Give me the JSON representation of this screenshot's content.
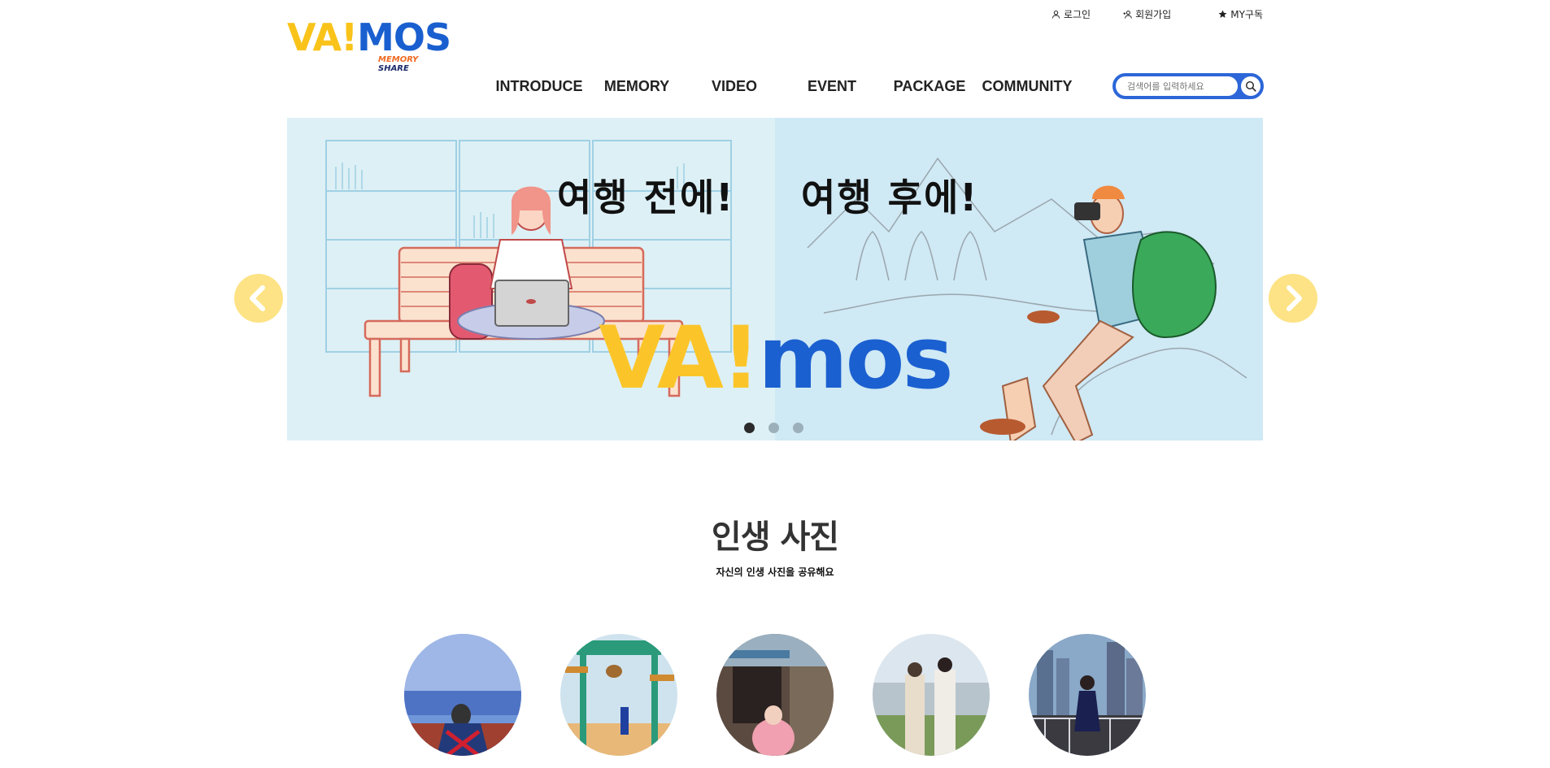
{
  "util": {
    "login": "로그인",
    "join": "회원가입",
    "subscribe": "MY구독"
  },
  "logo": {
    "word_yellow": "VA!",
    "word_blue": "MOS",
    "sub_memory": "MEMORY",
    "sub_share": "SHARE"
  },
  "nav": {
    "items": [
      "INTRODUCE",
      "MEMORY",
      "VIDEO",
      "EVENT",
      "PACKAGE",
      "COMMUNITY"
    ]
  },
  "search": {
    "placeholder": "검색어를 입력하세요"
  },
  "banner": {
    "heading_before": "여행 전에!",
    "heading_after": "여행 후에!",
    "big_yellow": "VA!",
    "big_blue": "mos",
    "slide_count": 3,
    "active_slide": 1
  },
  "section": {
    "title": "인생 사진",
    "subtitle": "자신의 인생 사진을 공유해요"
  },
  "colors": {
    "brand_yellow": "#f9c31a",
    "brand_blue": "#1a5fcf",
    "search_border": "#2c66d8",
    "arrow": "#fde385"
  },
  "photos": {
    "count": 5
  }
}
